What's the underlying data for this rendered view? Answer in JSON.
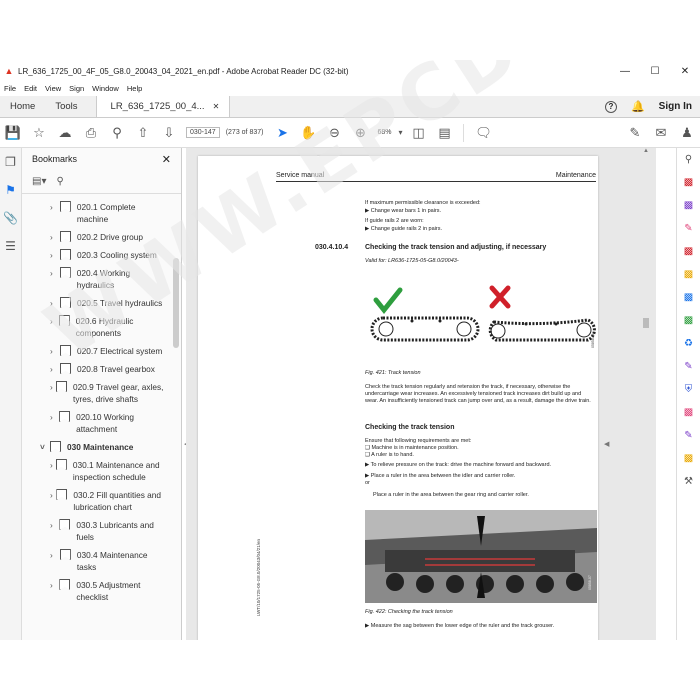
{
  "window": {
    "title": "LR_636_1725_00_4F_05_G8.0_20043_04_2021_en.pdf - Adobe Acrobat Reader DC (32-bit)",
    "minimize": "—",
    "maximize": "☐",
    "close": "✕"
  },
  "menu": [
    "File",
    "Edit",
    "View",
    "Sign",
    "Window",
    "Help"
  ],
  "tabs": {
    "home": "Home",
    "tools": "Tools",
    "doc": "LR_636_1725_00_4...",
    "doc_close": "✕",
    "signin": "Sign In"
  },
  "toolbar": {
    "page_label": "030-147",
    "page_count": "(273 of 837)",
    "zoom": "68%"
  },
  "bookmarks": {
    "title": "Bookmarks",
    "close": "✕",
    "items": [
      {
        "label": "020.1 Complete machine",
        "level": "sub"
      },
      {
        "label": "020.2 Drive group",
        "level": "sub"
      },
      {
        "label": "020.3 Cooling system",
        "level": "sub"
      },
      {
        "label": "020.4 Working hydraulics",
        "level": "sub"
      },
      {
        "label": "020.5 Travel hydraulics",
        "level": "sub"
      },
      {
        "label": "020.6 Hydraulic components",
        "level": "sub"
      },
      {
        "label": "020.7 Electrical system",
        "level": "sub"
      },
      {
        "label": "020.8 Travel gearbox",
        "level": "sub"
      },
      {
        "label": "020.9 Travel gear, axles, tyres, drive shafts",
        "level": "sub"
      },
      {
        "label": "020.10 Working attachment",
        "level": "sub"
      },
      {
        "label": "030 Maintenance",
        "level": "top"
      },
      {
        "label": "030.1 Maintenance and inspection schedule",
        "level": "sub"
      },
      {
        "label": "030.2 Fill quantities and lubrication chart",
        "level": "sub"
      },
      {
        "label": "030.3 Lubricants and fuels",
        "level": "sub"
      },
      {
        "label": "030.4 Maintenance tasks",
        "level": "sub"
      },
      {
        "label": "030.5 Adjustment checklist",
        "level": "sub"
      }
    ]
  },
  "page": {
    "header_left": "Service manual",
    "header_right": "Maintenance",
    "line1": "If maximum permissible clearance is exceeded:",
    "line2": "▶  Change wear bars 1 in pairs.",
    "line3": "If guide rails 2 are worn:",
    "line4": "▶  Change guide rails 2 in pairs.",
    "section_num": "030.4.10.4",
    "section_title": "Checking the track tension and adjusting, if necessary",
    "valid_for": "Valid for: LR636-1725-05-G8.0/20043-",
    "fig1_caption": "Fig. 421: Track tension",
    "para1": "Check the track tension regularly and retension the track, if necessary, otherwise the undercarriage wear increases. An excessively tensioned track increases dirt build up and wear. An insufficiently tensioned track can jump over and, as a result, damage the drive train.",
    "subsection": "Checking the track tension",
    "req_intro": "Ensure that following requirements are met:",
    "req1": "❑  Machine is in maintenance position.",
    "req2": "❑  A ruler is to hand.",
    "step1": "▶  To relieve pressure on the track: drive the machine forward and backward.",
    "step2": "▶  Place a ruler in the area between the idler and carrier roller.",
    "or": "or",
    "step3": "Place a ruler in the area between the gear ring and carrier roller.",
    "fig2_caption": "Fig. 422: Checking the track tension",
    "step4": "▶  Measure the sag between the lower edge of the ruler and the track grouser.",
    "side_code": "LWT/10/1725-05-G8.0/20043/04/21/en",
    "fig_code1": "05858-01",
    "fig_code2": "05858-07"
  },
  "watermark": "WWW.EPCDEPO.COM",
  "colors": {
    "check": "#2e9e3e",
    "cross": "#d0202a",
    "ruler": "#e23b3b"
  }
}
